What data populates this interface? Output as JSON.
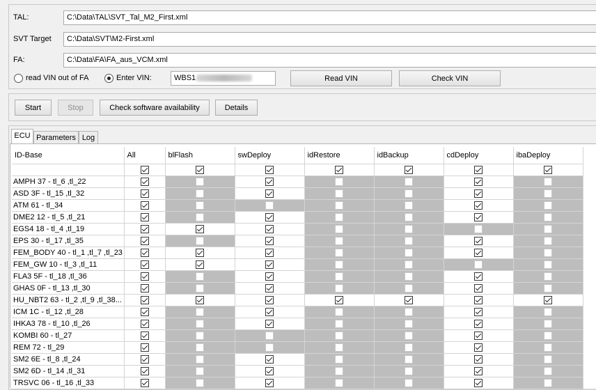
{
  "top": {
    "tal_label": "TAL:",
    "tal_value": "C:\\Data\\TAL\\SVT_Tal_M2_First.xml",
    "svt_label": "SVT Target",
    "svt_value": "C:\\Data\\SVT\\M2-First.xml",
    "fa_label": "FA:",
    "fa_value": "C:\\Data\\FA\\FA_aus_VCM.xml",
    "radio_fa_label": "read VIN out of FA",
    "radio_enter_label": "Enter VIN:",
    "vin_value": "WBS1",
    "read_vin_label": "Read VIN",
    "check_vin_label": "Check VIN"
  },
  "actions": {
    "start_label": "Start",
    "stop_label": "Stop",
    "check_sw_label": "Check software availability",
    "details_label": "Details"
  },
  "tabs": [
    "ECU",
    "Parameters",
    "Log"
  ],
  "columns": [
    "ID-Base",
    "All",
    "blFlash",
    "swDeploy",
    "idRestore",
    "idBackup",
    "cdDeploy",
    "ibaDeploy"
  ],
  "all_row": [
    1,
    1,
    1,
    1,
    1,
    1,
    1
  ],
  "rows": [
    {
      "name": "AMPH 37 - tl_6 ,tl_22",
      "cells": [
        1,
        0,
        1,
        0,
        0,
        1,
        0
      ],
      "enabled": [
        1,
        0,
        1,
        0,
        0,
        1,
        0
      ]
    },
    {
      "name": "ASD 3F - tl_15 ,tl_32",
      "cells": [
        1,
        0,
        1,
        0,
        0,
        1,
        0
      ],
      "enabled": [
        1,
        0,
        1,
        0,
        0,
        1,
        0
      ]
    },
    {
      "name": "ATM 61 - tl_34",
      "cells": [
        1,
        0,
        0,
        0,
        0,
        1,
        0
      ],
      "enabled": [
        1,
        0,
        0,
        0,
        0,
        1,
        0
      ]
    },
    {
      "name": "DME2 12 - tl_5 ,tl_21",
      "cells": [
        1,
        0,
        1,
        0,
        0,
        1,
        0
      ],
      "enabled": [
        1,
        0,
        1,
        0,
        0,
        1,
        0
      ]
    },
    {
      "name": "EGS4 18 - tl_4 ,tl_19",
      "cells": [
        1,
        1,
        1,
        0,
        0,
        0,
        0
      ],
      "enabled": [
        1,
        1,
        1,
        0,
        0,
        0,
        0
      ]
    },
    {
      "name": "EPS 30 - tl_17 ,tl_35",
      "cells": [
        1,
        0,
        1,
        0,
        0,
        1,
        0
      ],
      "enabled": [
        1,
        0,
        1,
        0,
        0,
        1,
        0
      ]
    },
    {
      "name": "FEM_BODY 40 - tl_1 ,tl_7 ,tl_23",
      "cells": [
        1,
        1,
        1,
        0,
        0,
        1,
        0
      ],
      "enabled": [
        1,
        1,
        1,
        0,
        0,
        1,
        0
      ]
    },
    {
      "name": "FEM_GW 10 - tl_3 ,tl_11",
      "cells": [
        1,
        1,
        1,
        0,
        0,
        0,
        0
      ],
      "enabled": [
        1,
        1,
        1,
        0,
        0,
        0,
        0
      ]
    },
    {
      "name": "FLA3 5F - tl_18 ,tl_36",
      "cells": [
        1,
        0,
        1,
        0,
        0,
        1,
        0
      ],
      "enabled": [
        1,
        0,
        1,
        0,
        0,
        1,
        0
      ]
    },
    {
      "name": "GHAS 0F - tl_13 ,tl_30",
      "cells": [
        1,
        0,
        1,
        0,
        0,
        1,
        0
      ],
      "enabled": [
        1,
        0,
        1,
        0,
        0,
        1,
        0
      ]
    },
    {
      "name": "HU_NBT2 63 - tl_2 ,tl_9 ,tl_38...",
      "cells": [
        1,
        1,
        1,
        1,
        1,
        1,
        1
      ],
      "enabled": [
        1,
        1,
        1,
        1,
        1,
        1,
        1
      ]
    },
    {
      "name": "ICM 1C - tl_12 ,tl_28",
      "cells": [
        1,
        0,
        1,
        0,
        0,
        1,
        0
      ],
      "enabled": [
        1,
        0,
        1,
        0,
        0,
        1,
        0
      ]
    },
    {
      "name": "IHKA3 78 - tl_10 ,tl_26",
      "cells": [
        1,
        0,
        1,
        0,
        0,
        1,
        0
      ],
      "enabled": [
        1,
        0,
        1,
        0,
        0,
        1,
        0
      ]
    },
    {
      "name": "KOMBI 60 - tl_27",
      "cells": [
        1,
        0,
        0,
        0,
        0,
        1,
        0
      ],
      "enabled": [
        1,
        0,
        0,
        0,
        0,
        1,
        0
      ]
    },
    {
      "name": "REM 72 - tl_29",
      "cells": [
        1,
        0,
        0,
        0,
        0,
        1,
        0
      ],
      "enabled": [
        1,
        0,
        0,
        0,
        0,
        1,
        0
      ]
    },
    {
      "name": "SM2 6E - tl_8 ,tl_24",
      "cells": [
        1,
        0,
        1,
        0,
        0,
        1,
        0
      ],
      "enabled": [
        1,
        0,
        1,
        0,
        0,
        1,
        0
      ]
    },
    {
      "name": "SM2 6D - tl_14 ,tl_31",
      "cells": [
        1,
        0,
        1,
        0,
        0,
        1,
        0
      ],
      "enabled": [
        1,
        0,
        1,
        0,
        0,
        1,
        0
      ]
    },
    {
      "name": "TRSVC 06 - tl_16 ,tl_33",
      "cells": [
        1,
        0,
        1,
        0,
        0,
        1,
        0
      ],
      "enabled": [
        1,
        0,
        1,
        0,
        0,
        1,
        0
      ]
    }
  ]
}
